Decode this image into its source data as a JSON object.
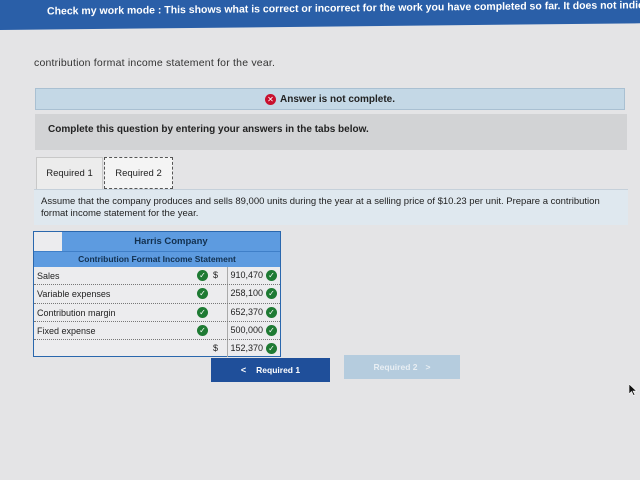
{
  "banner": {
    "text": "Check my work mode : This shows what is correct or incorrect for the work you have completed so far. It does not indicate"
  },
  "cutoff_text": "contribution format income statement for the year.",
  "status": {
    "icon": "x-circle-icon",
    "text": "Answer is not complete.",
    "icon_color": "#c8102e"
  },
  "instruction": "Complete this question by entering your answers in the tabs below.",
  "tabs": [
    {
      "label": "Required 1",
      "active": false
    },
    {
      "label": "Required 2",
      "active": true
    }
  ],
  "question": "Assume that the company produces and sells 89,000 units during the year at a selling price of $10.23 per unit. Prepare a contribution format income statement for the year.",
  "table": {
    "company": "Harris Company",
    "title": "Contribution Format Income Statement",
    "rows": [
      {
        "label": "Sales",
        "currency": "$",
        "amount": "910,470",
        "label_correct": true,
        "amount_correct": true
      },
      {
        "label": "Variable expenses",
        "currency": "",
        "amount": "258,100",
        "label_correct": true,
        "amount_correct": true
      },
      {
        "label": "Contribution margin",
        "currency": "",
        "amount": "652,370",
        "label_correct": true,
        "amount_correct": true
      },
      {
        "label": "Fixed expense",
        "currency": "",
        "amount": "500,000",
        "label_correct": true,
        "amount_correct": true
      },
      {
        "label": "",
        "currency": "$",
        "amount": "152,370",
        "label_correct": false,
        "amount_correct": true
      }
    ]
  },
  "buttons": {
    "prev": {
      "label": "Required 1",
      "arrow": "<"
    },
    "next": {
      "label": "Required 2",
      "arrow": ">"
    }
  },
  "colors": {
    "banner": "#2a5fa8",
    "check": "#1e7a33",
    "table_header": "#5d9be0",
    "prev_button": "#1f4f9a"
  }
}
